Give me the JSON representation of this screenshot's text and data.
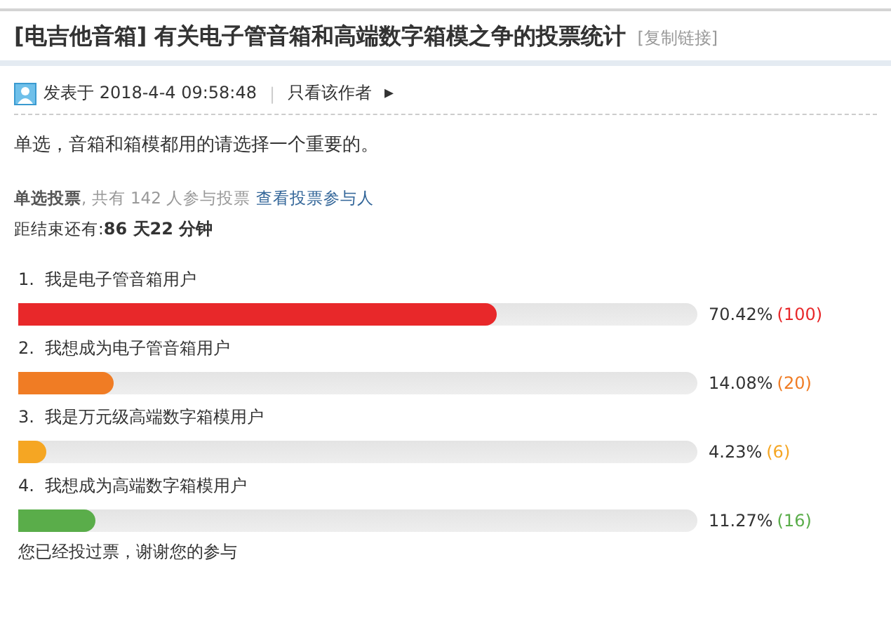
{
  "title": {
    "category": "[电吉他音箱]",
    "text": "有关电子管音箱和高端数字箱模之争的投票统计",
    "copy_link": "[复制链接]"
  },
  "meta": {
    "posted": "发表于 2018-4-4 09:58:48",
    "separator": "|",
    "author_only": "只看该作者",
    "arrow": "▸"
  },
  "body": "单选，音箱和箱模都用的请选择一个重要的。",
  "poll": {
    "type": "单选投票",
    "summary": ", 共有 142 人参与投票",
    "voters_link": "查看投票参与人",
    "remaining_label": "距结束还有:",
    "remaining": "86 天22 分钟"
  },
  "options": [
    {
      "number": "1.",
      "label": "我是电子管音箱用户",
      "level": 0.7042,
      "percent": "70.42%",
      "count": "(100)",
      "color": "#e8282a"
    },
    {
      "number": "2.",
      "label": "我想成为电子管音箱用户",
      "level": 0.1408,
      "percent": "14.08%",
      "count": "(20)",
      "color": "#f07c24"
    },
    {
      "number": "3.",
      "label": "我是万元级高端数字箱模用户",
      "level": 0.0423,
      "percent": "4.23%",
      "count": "(6)",
      "color": "#f5a623"
    },
    {
      "number": "4.",
      "label": "我想成为高端数字箱模用户",
      "level": 0.1127,
      "percent": "11.27%",
      "count": "(16)",
      "color": "#5aad4a"
    }
  ],
  "footer": "您已经投过票，谢谢您的参与"
}
